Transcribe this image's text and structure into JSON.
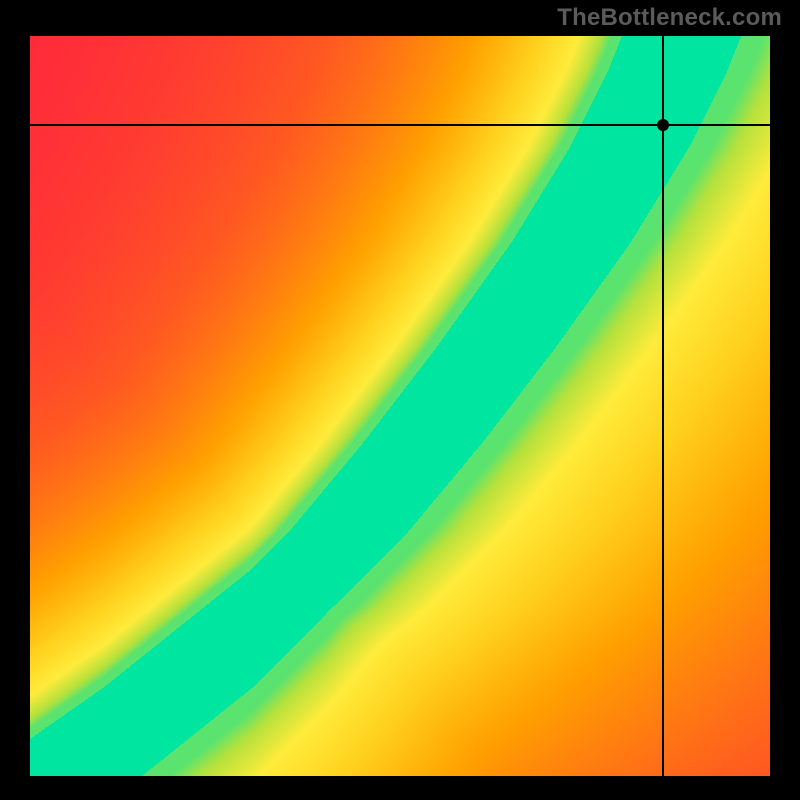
{
  "watermark": "TheBottleneck.com",
  "chart_data": {
    "type": "heatmap",
    "title": "",
    "xlabel": "",
    "ylabel": "",
    "xlim": [
      0,
      1
    ],
    "ylim": [
      0,
      1
    ],
    "grid": false,
    "legend": false,
    "color_scale": [
      "#ff1744",
      "#ff5722",
      "#ff9800",
      "#ffc107",
      "#ffeb3b",
      "#cddc39",
      "#4caf50",
      "#00e5a0"
    ],
    "ridge": {
      "description": "Optimal (green) band follows a monotone curve from bottom-left toward upper-right; away from it compatibility degrades through yellow→orange→red.",
      "control_points_xy": [
        [
          0.0,
          0.0
        ],
        [
          0.1,
          0.07
        ],
        [
          0.2,
          0.15
        ],
        [
          0.3,
          0.23
        ],
        [
          0.4,
          0.33
        ],
        [
          0.5,
          0.45
        ],
        [
          0.6,
          0.58
        ],
        [
          0.7,
          0.72
        ],
        [
          0.78,
          0.85
        ],
        [
          0.83,
          0.95
        ],
        [
          0.85,
          1.0
        ]
      ],
      "green_half_width_frac": 0.05
    },
    "marker": {
      "x_frac": 0.856,
      "y_frac": 0.88
    },
    "crosshair": {
      "x_frac": 0.856,
      "y_frac": 0.88
    }
  },
  "colors": {
    "frame": "#000000",
    "watermark": "#5b5b5b"
  }
}
